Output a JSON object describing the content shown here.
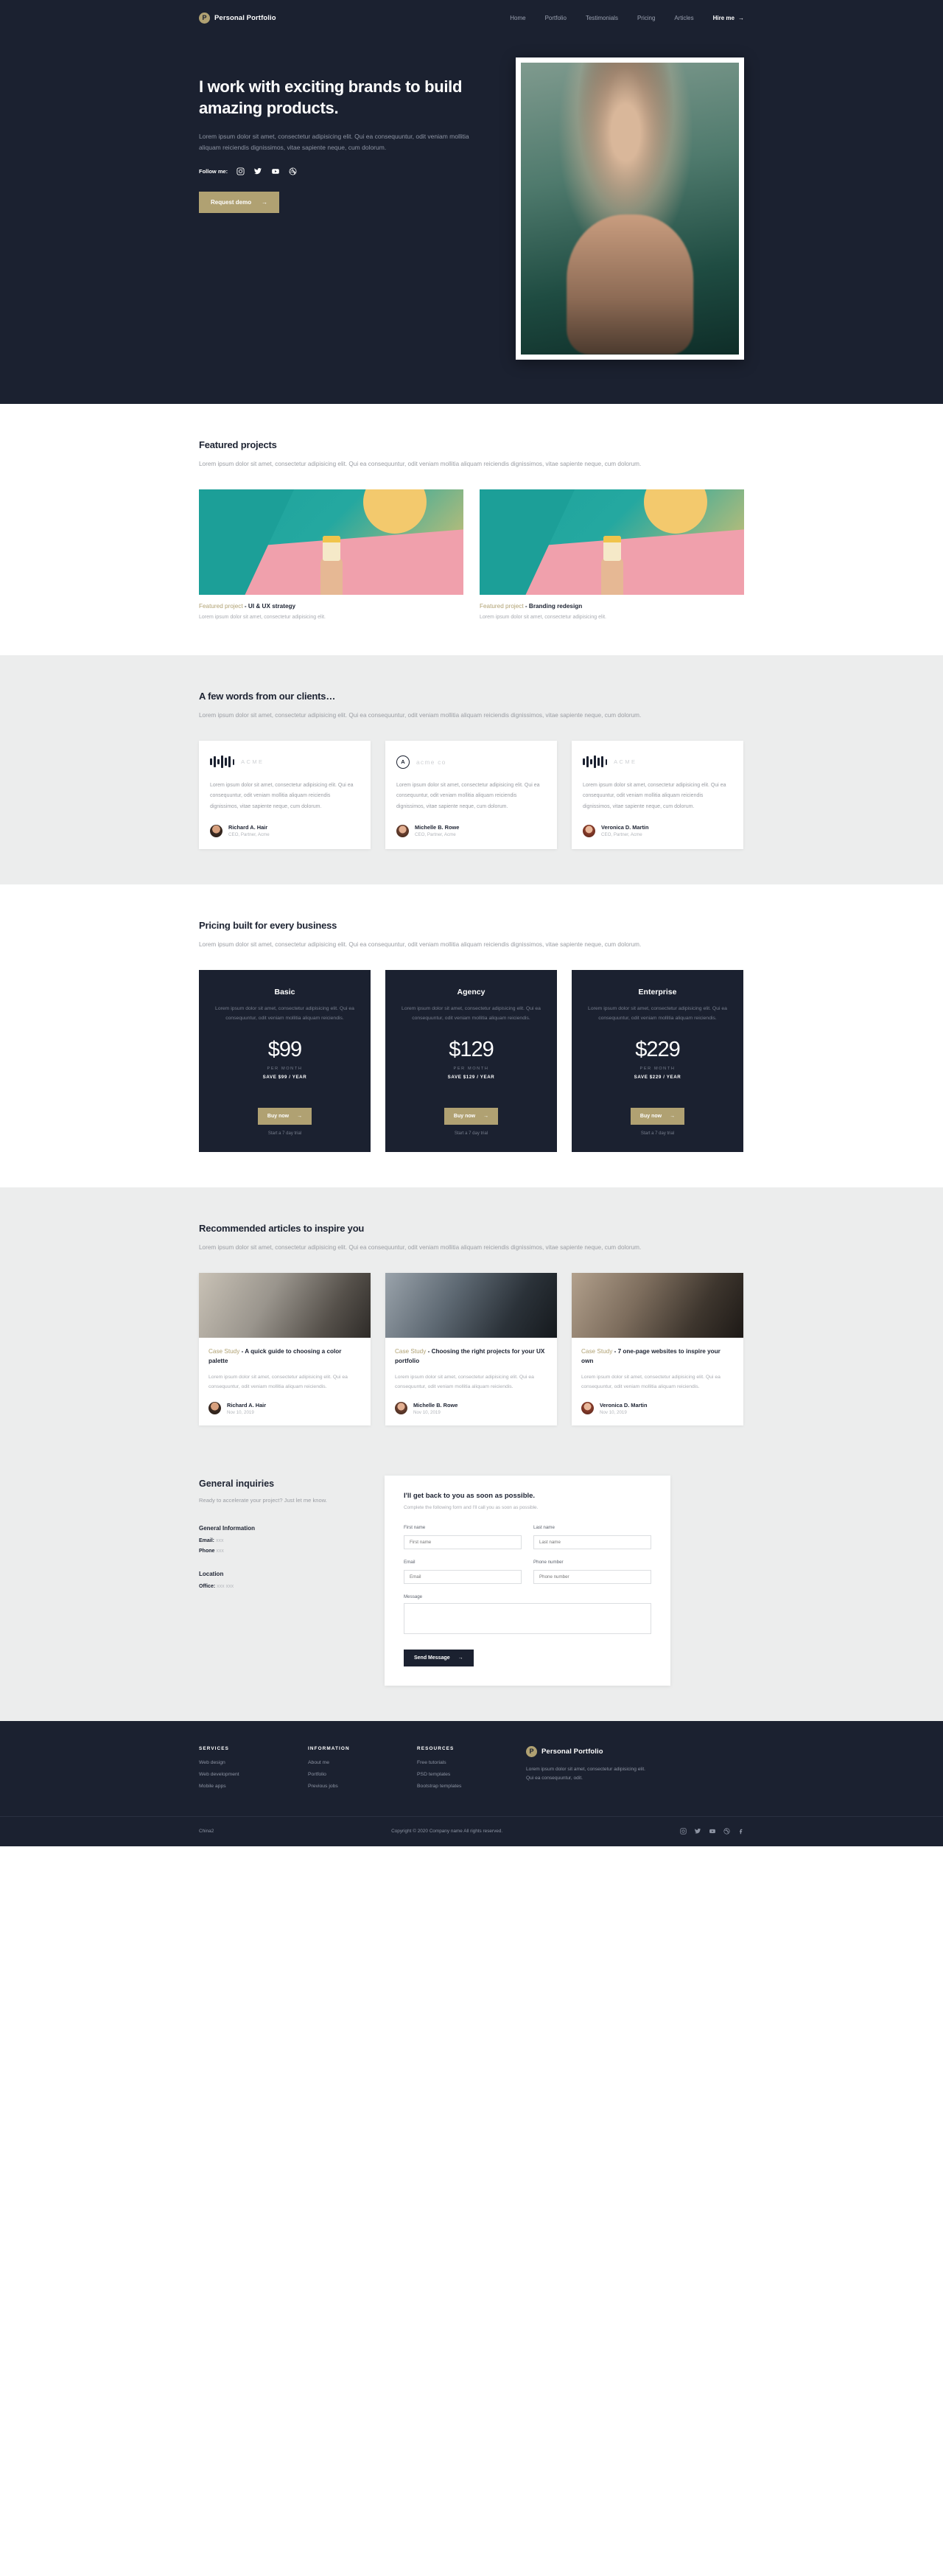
{
  "brand": {
    "mark": "P",
    "name": "Personal Portfolio"
  },
  "nav": {
    "items": [
      "Home",
      "Portfolio",
      "Testimonials",
      "Pricing",
      "Articles"
    ],
    "cta": "Hire me",
    "cta_arrow": "→"
  },
  "hero": {
    "heading": "I work with exciting brands to build amazing products.",
    "paragraph": "Lorem ipsum dolor sit amet, consectetur adipisicing elit. Qui ea consequuntur, odit veniam mollitia aliquam reiciendis dignissimos, vitae sapiente neque, cum dolorum.",
    "follow_label": "Follow me:",
    "socials": [
      "instagram-icon",
      "twitter-icon",
      "youtube-icon",
      "dribbble-icon"
    ],
    "cta": "Request demo",
    "cta_arrow": "→"
  },
  "projects": {
    "heading": "Featured projects",
    "paragraph": "Lorem ipsum dolor sit amet, consectetur adipisicing elit. Qui ea consequuntur, odit veniam mollitia aliquam reiciendis dignissimos, vitae sapiente neque, cum dolorum.",
    "items": [
      {
        "kicker": "Featured project",
        "title": " - UI & UX strategy",
        "desc": "Lorem ipsum dolor sit amet, consectetur adipisicing elit."
      },
      {
        "kicker": "Featured project",
        "title": " - Branding redesign",
        "desc": "Lorem ipsum dolor sit amet, consectetur adipisicing elit."
      }
    ]
  },
  "testimonials": {
    "heading": "A few words from our clients…",
    "paragraph": "Lorem ipsum dolor sit amet, consectetur adipisicing elit. Qui ea consequuntur, odit veniam mollitia aliquam reiciendis dignissimos, vitae sapiente neque, cum dolorum.",
    "quote": "Lorem ipsum dolor sit amet, consectetur adipisicing elit. Qui ea consequuntur, odit veniam mollitia aliquam reiciendis dignissimos, vitae sapiente neque, cum dolorum.",
    "items": [
      {
        "logo_word": "ACME",
        "logo_type": "bars",
        "name": "Richard A. Hair",
        "role": "CEO, Partner, Acme"
      },
      {
        "logo_word": "acme co",
        "logo_type": "ring",
        "ring_letter": "A",
        "name": "Michelle B. Rowe",
        "role": "CEO, Partner, Acme"
      },
      {
        "logo_word": "ACME",
        "logo_type": "bars",
        "name": "Veronica D. Martin",
        "role": "CEO, Partner, Acme"
      }
    ]
  },
  "pricing": {
    "heading": "Pricing built for every business",
    "paragraph": "Lorem ipsum dolor sit amet, consectetur adipisicing elit. Qui ea consequuntur, odit veniam mollitia aliquam reiciendis dignissimos, vitae sapiente neque, cum dolorum.",
    "desc": "Lorem ipsum dolor sit amet, consectetur adipisicing elit. Qui ea consequuntur, odit veniam mollitia aliquam reiciendis.",
    "per": "PER MONTH",
    "buy_label": "Buy now",
    "buy_arrow": "→",
    "trial": "Start a 7 day trial",
    "plans": [
      {
        "name": "Basic",
        "price": "$99",
        "save": "SAVE $99 / YEAR"
      },
      {
        "name": "Agency",
        "price": "$129",
        "save": "SAVE $129 / YEAR"
      },
      {
        "name": "Enterprise",
        "price": "$229",
        "save": "SAVE $229 / YEAR"
      }
    ]
  },
  "articles": {
    "heading": "Recommended articles to inspire you",
    "paragraph": "Lorem ipsum dolor sit amet, consectetur adipisicing elit. Qui ea consequuntur, odit veniam mollitia aliquam reiciendis dignissimos, vitae sapiente neque, cum dolorum.",
    "desc": "Lorem ipsum dolor sit amet, consectetur adipisicing elit. Qui ea consequuntur, odit veniam mollitia aliquam reiciendis.",
    "items": [
      {
        "kicker": "Case Study",
        "title": " - A quick guide to choosing a color palette",
        "name": "Richard A. Hair",
        "date": "Nov 10, 2019"
      },
      {
        "kicker": "Case Study",
        "title": " - Choosing the right projects for your UX portfolio",
        "name": "Michelle B. Rowe",
        "date": "Nov 10, 2019"
      },
      {
        "kicker": "Case Study",
        "title": " - 7 one-page websites to inspire your own",
        "name": "Veronica D. Martin",
        "date": "Nov 10, 2019"
      }
    ]
  },
  "contact": {
    "heading": "General inquiries",
    "sub": "Ready to accelerate your project? Just let me know.",
    "general_h": "General Information",
    "email_label": "Email:",
    "email_value": "xxx",
    "phone_label": "Phone",
    "phone_value": "xxx",
    "location_h": "Location",
    "office_label": "Office:",
    "office_value": "xxx xxx",
    "form": {
      "heading": "I'll get back to you as soon as possible.",
      "sub": "Complete the following form and I'll call you as soon as possible.",
      "first_label": "First name",
      "first_ph": "First name",
      "last_label": "Last name",
      "last_ph": "Last name",
      "email_label": "Email",
      "email_ph": "Email",
      "phone_label": "Phone number",
      "phone_ph": "Phone number",
      "message_label": "Message",
      "message_ph": "",
      "submit": "Send Message",
      "submit_arrow": "→"
    }
  },
  "footer": {
    "columns": [
      {
        "title": "SERVICES",
        "links": [
          "Web design",
          "Web development",
          "Mobile apps"
        ]
      },
      {
        "title": "INFORMATION",
        "links": [
          "About me",
          "Portfolio",
          "Previous jobs"
        ]
      },
      {
        "title": "RESOURCES",
        "links": [
          "Free tutorials",
          "PSD templates",
          "Bootstrap templates"
        ]
      }
    ],
    "brand_name": "Personal Portfolio",
    "about": "Lorem ipsum dolor sit amet, consectetur adipisicing elit. Qui ea consequuntur, odit.",
    "left_legal": "China2",
    "copyright": "Copyright © 2020 Company name All rights reserved.",
    "socials": [
      "instagram-icon",
      "twitter-icon",
      "youtube-icon",
      "dribbble-icon",
      "facebook-icon"
    ]
  },
  "colors": {
    "dark": "#1b2130",
    "gold": "#b0a172",
    "grey_bg": "#eceded"
  }
}
